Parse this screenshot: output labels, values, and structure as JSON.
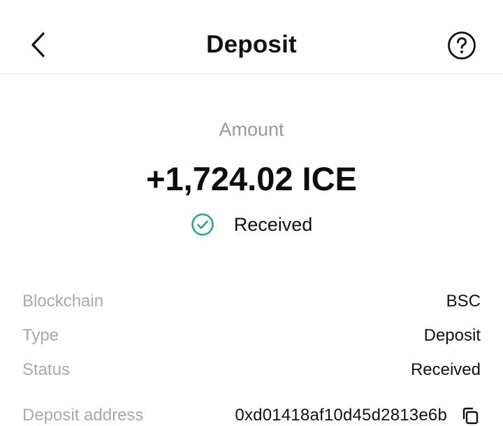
{
  "header": {
    "title": "Deposit",
    "back_icon": "chevron-left-icon",
    "help_icon": "question-circle-icon"
  },
  "summary": {
    "amount_label": "Amount",
    "amount_value": "+1,724.02 ICE",
    "status_icon": "check-circle-icon",
    "status_text": "Received",
    "status_color": "#1fa88f"
  },
  "details": {
    "rows": [
      {
        "label": "Blockchain",
        "value": "BSC"
      },
      {
        "label": "Type",
        "value": "Deposit"
      },
      {
        "label": "Status",
        "value": "Received"
      },
      {
        "label": "Deposit address",
        "value": "0xd01418af10d45d2813e6b"
      }
    ],
    "copy_icon": "copy-icon"
  }
}
